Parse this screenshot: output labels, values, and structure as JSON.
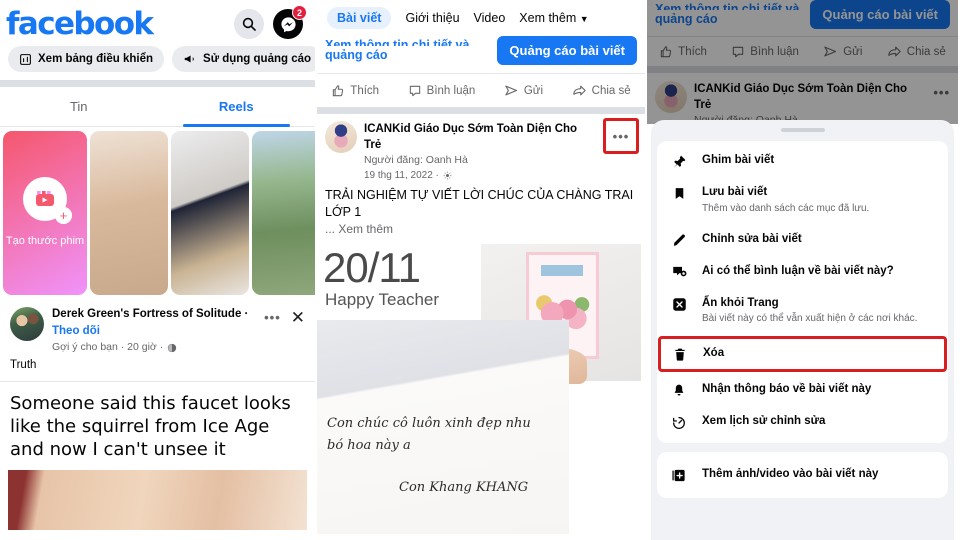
{
  "left_panel": {
    "brand": "facebook",
    "icons": {
      "search": "search-icon",
      "messenger": "messenger-icon"
    },
    "messenger_badge": "2",
    "pills": [
      {
        "label": "Xem bảng điều khiển",
        "icon": "dashboard-icon"
      },
      {
        "label": "Sử dụng quảng cáo",
        "icon": "megaphone-icon"
      }
    ],
    "tabs": [
      {
        "label": "Tin",
        "active": false
      },
      {
        "label": "Reels",
        "active": true
      }
    ],
    "reels": {
      "create_label": "Tạo thước phim",
      "items": [
        "reel-baby",
        "reel-ladies",
        "reel-beach"
      ]
    },
    "suggested_post": {
      "page_name": "Derek Green's Fortress of Solitude ·",
      "follow_label": "Theo dõi",
      "meta": "Gợi ý cho bạn · 20 giờ ·",
      "globe_icon": "globe-icon",
      "more_icon": "more-dots-icon",
      "close_icon": "close-icon",
      "subtitle": "Truth",
      "body": "Someone said this faucet looks like the squirrel from Ice Age and now I can't unsee it"
    }
  },
  "mid_panel": {
    "tabs": [
      {
        "label": "Bài viết",
        "selected": true
      },
      {
        "label": "Giới thiệu",
        "selected": false
      },
      {
        "label": "Video",
        "selected": false
      },
      {
        "label": "Xem thêm",
        "selected": false,
        "caret": "chevron-down-icon"
      }
    ],
    "promo_link_top": "Xem thông tin chi tiết và",
    "promo_link": "quảng cáo",
    "boost_button": "Quảng cáo bài viết",
    "actions": [
      {
        "label": "Thích",
        "icon": "thumbs-up-icon"
      },
      {
        "label": "Bình luận",
        "icon": "comment-icon"
      },
      {
        "label": "Gửi",
        "icon": "send-icon"
      },
      {
        "label": "Chia sẻ",
        "icon": "share-icon"
      }
    ],
    "post": {
      "page_name": "ICANKid Giáo Dục Sớm Toàn Diện Cho Trẻ",
      "poster": "Người đăng: Oanh Hà",
      "date": "19 thg 11, 2022 ·",
      "audience_icon": "gear-icon",
      "more_icon": "more-dots-icon",
      "caption": "TRẢI NGHIỆM TỰ VIẾT LỜI CHÚC CỦA CHÀNG TRAI LỚP 1",
      "see_more": "... Xem thêm",
      "media_date": "20/11",
      "media_subtitle": "Happy Teacher",
      "handwriting": [
        "Con chúc cô luôn xinh đẹp nhu",
        "bó hoa này a",
        "Con Khang KHANG"
      ]
    }
  },
  "right_panel": {
    "promo_link_top": "Xem thông tin chi tiết và",
    "promo_link": "quảng cáo",
    "boost_button": "Quảng cáo bài viết",
    "actions": [
      {
        "label": "Thích",
        "icon": "thumbs-up-icon"
      },
      {
        "label": "Bình luận",
        "icon": "comment-icon"
      },
      {
        "label": "Gửi",
        "icon": "send-icon"
      },
      {
        "label": "Chia sẻ",
        "icon": "share-icon"
      }
    ],
    "post": {
      "page_name": "ICANKid Giáo Dục Sớm Toàn Diện Cho Trẻ",
      "poster": "Người đăng: Oanh Hà",
      "more_icon": "more-dots-icon"
    },
    "menu": {
      "items": [
        {
          "title": "Ghim bài viết",
          "sub": "",
          "icon": "pin-icon",
          "highlighted": false
        },
        {
          "title": "Lưu bài viết",
          "sub": "Thêm vào danh sách các mục đã lưu.",
          "icon": "bookmark-icon",
          "highlighted": false
        },
        {
          "title": "Chỉnh sửa bài viết",
          "sub": "",
          "icon": "pencil-icon",
          "highlighted": false
        },
        {
          "title": "Ai có thể bình luận về bài viết này?",
          "sub": "",
          "icon": "comment-shield-icon",
          "highlighted": false
        },
        {
          "title": "Ẩn khỏi Trang",
          "sub": "Bài viết này có thể vẫn xuất hiện ở các nơi khác.",
          "icon": "hide-x-icon",
          "highlighted": false
        },
        {
          "title": "Xóa",
          "sub": "",
          "icon": "trash-icon",
          "highlighted": true
        },
        {
          "title": "Nhận thông báo về bài viết này",
          "sub": "",
          "icon": "bell-icon",
          "highlighted": false
        },
        {
          "title": "Xem lịch sử chỉnh sửa",
          "sub": "",
          "icon": "history-icon",
          "highlighted": false
        }
      ],
      "secondary_items": [
        {
          "title": "Thêm ảnh/video vào bài viết này",
          "sub": "",
          "icon": "add-photo-icon"
        }
      ]
    }
  },
  "colors": {
    "facebook_blue": "#1877F2",
    "highlight_red": "#D81E1E",
    "badge_red": "#E41E3F",
    "grey_divider": "#DCDFE3"
  }
}
